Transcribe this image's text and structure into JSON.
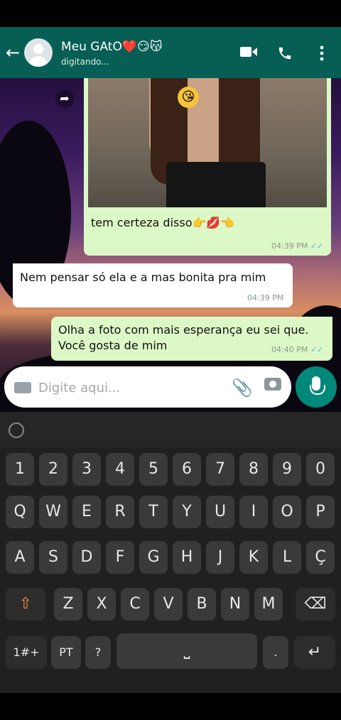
{
  "header": {
    "contact_name": "Meu GAtO❤️😏😽",
    "status": "digitando...",
    "icons": [
      "back-arrow-icon",
      "avatar",
      "video-call-icon",
      "phone-call-icon",
      "more-vert-icon"
    ]
  },
  "messages": [
    {
      "direction": "out",
      "type": "image",
      "caption": "tem certeza disso👉💋👈",
      "time": "04:39 PM",
      "ticks": "✓✓"
    },
    {
      "direction": "in",
      "text": "Nem pensar só ela e a mas bonita pra mim",
      "time": "04:39 PM"
    },
    {
      "direction": "out",
      "lines": [
        "Olha a foto com mais esperança eu sei que.",
        "Você gosta de mim"
      ],
      "time": "04:40 PM",
      "ticks": "✓✓"
    }
  ],
  "composer": {
    "placeholder": "Digite aqui...",
    "icons": [
      "keyboard-icon",
      "attach-icon",
      "camera-icon",
      "mic-icon"
    ]
  },
  "keyboard": {
    "numbers": [
      "1",
      "2",
      "3",
      "4",
      "5",
      "6",
      "7",
      "8",
      "9",
      "0"
    ],
    "row1": [
      "Q",
      "W",
      "E",
      "R",
      "T",
      "Y",
      "U",
      "I",
      "O",
      "P"
    ],
    "row2": [
      "A",
      "S",
      "D",
      "F",
      "G",
      "H",
      "J",
      "K",
      "L",
      "Ç"
    ],
    "row3": [
      "Z",
      "X",
      "C",
      "V",
      "B",
      "N",
      "M"
    ],
    "symbols": "1#+",
    "lang": "PT",
    "question": "?",
    "period": "."
  },
  "colors": {
    "header": "#075e54",
    "outgoing": "#dcf8c6",
    "incoming": "#ffffff",
    "mic": "#00897b",
    "keyboard": "#202020",
    "key": "#3a3a3a"
  }
}
